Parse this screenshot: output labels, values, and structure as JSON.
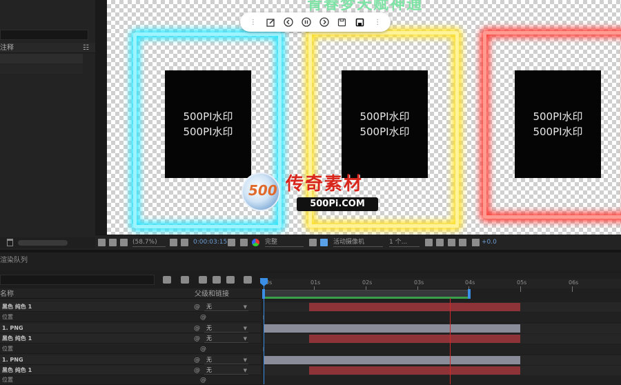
{
  "project_panel": {
    "column_header": "注释"
  },
  "viewer": {
    "composition_title": "青春梦天赋神通",
    "frames": [
      {
        "color": "#27e6ff",
        "text_line1": "500PI水印",
        "text_line2": "500PI水印"
      },
      {
        "color": "#ffe022",
        "text_line1": "500PI水印",
        "text_line2": "500PI水印"
      },
      {
        "color": "#ff3a34",
        "text_line1": "500PI水印",
        "text_line2": "500PI水印"
      }
    ],
    "watermark": {
      "logo_text": "500",
      "brand_cn": "传奇素材",
      "brand_url": "500Pi.COM"
    },
    "toolbar_icons": [
      "edit-icon",
      "previous-icon",
      "pause-icon",
      "next-icon",
      "save-icon",
      "save-as-icon"
    ]
  },
  "viewer_bar": {
    "zoom": "(58.7%)",
    "timecode": "0:00:03:15",
    "resolution": "完整",
    "camera": "活动摄像机",
    "views": "1 个...",
    "exposure": "+0.0"
  },
  "timeline": {
    "tab_label": "渲染队列",
    "col_name": "名称",
    "col_parent": "父级和链接",
    "ruler_ticks": [
      "0s",
      "01s",
      "02s",
      "03s",
      "04s",
      "05s",
      "06s"
    ],
    "layers": [
      {
        "name": "黑色 纯色 1",
        "parent": "无",
        "kind": "main"
      },
      {
        "name": "位置",
        "kind": "prop"
      },
      {
        "name": "1. PNG",
        "parent": "无",
        "kind": "main"
      },
      {
        "name": "黑色 纯色 1",
        "parent": "无",
        "kind": "main"
      },
      {
        "name": "位置",
        "kind": "prop"
      },
      {
        "name": "1. PNG",
        "parent": "无",
        "kind": "main"
      },
      {
        "name": "黑色 纯色 1",
        "parent": "无",
        "kind": "main"
      },
      {
        "name": "位置",
        "kind": "prop"
      }
    ]
  }
}
